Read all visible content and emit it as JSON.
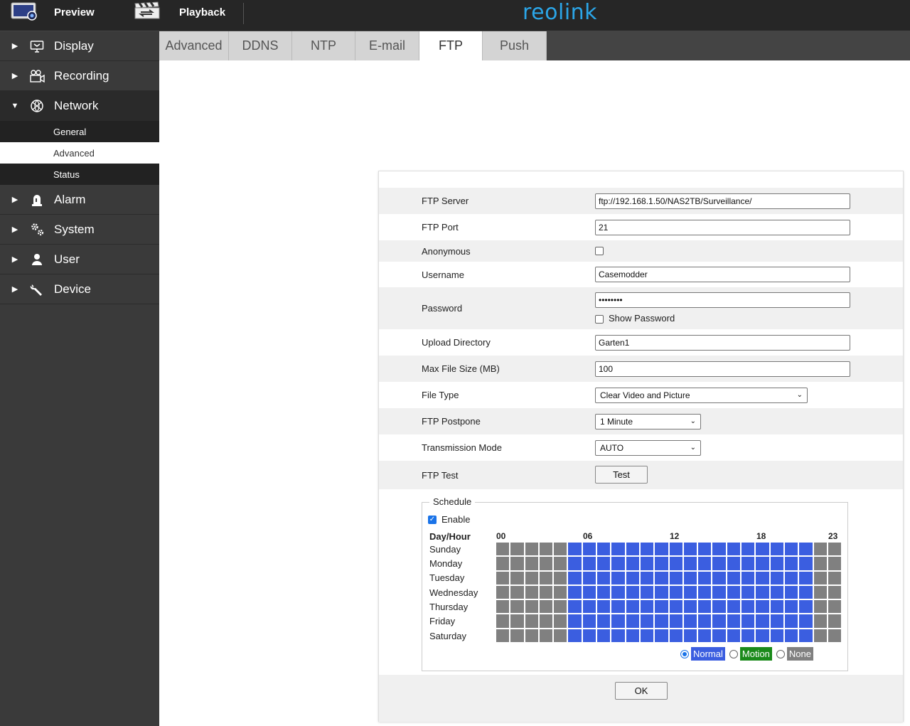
{
  "topbar": {
    "preview_label": "Preview",
    "playback_label": "Playback",
    "logo": "reolink"
  },
  "sidebar": {
    "items": [
      {
        "label": "Display",
        "icon": "monitor-icon"
      },
      {
        "label": "Recording",
        "icon": "camera-icon"
      },
      {
        "label": "Network",
        "icon": "network-globe-icon"
      },
      {
        "label": "Alarm",
        "icon": "alarm-icon"
      },
      {
        "label": "System",
        "icon": "gears-icon"
      },
      {
        "label": "User",
        "icon": "user-icon"
      },
      {
        "label": "Device",
        "icon": "wrench-icon"
      }
    ],
    "network_sub": [
      "General",
      "Advanced",
      "Status"
    ],
    "active_sub": "Advanced"
  },
  "tabs": [
    "Advanced",
    "DDNS",
    "NTP",
    "E-mail",
    "FTP",
    "Push"
  ],
  "active_tab": "FTP",
  "form": {
    "ftp_server_label": "FTP Server",
    "ftp_server_value": "ftp://192.168.1.50/NAS2TB/Surveillance/",
    "ftp_port_label": "FTP Port",
    "ftp_port_value": "21",
    "anonymous_label": "Anonymous",
    "username_label": "Username",
    "username_value": "Casemodder",
    "password_label": "Password",
    "password_value": "••••••••",
    "show_password_label": "Show Password",
    "upload_dir_label": "Upload Directory",
    "upload_dir_value": "Garten1",
    "max_file_label": "Max File Size (MB)",
    "max_file_value": "100",
    "file_type_label": "File Type",
    "file_type_value": "Clear Video and Picture",
    "postpone_label": "FTP Postpone",
    "postpone_value": "1 Minute",
    "transmission_label": "Transmission Mode",
    "transmission_value": "AUTO",
    "ftp_test_label": "FTP Test",
    "test_button": "Test",
    "ok_button": "OK"
  },
  "schedule": {
    "legend": "Schedule",
    "enable_label": "Enable",
    "enabled": true,
    "header_label": "Day/Hour",
    "hour_marks": [
      "00",
      "06",
      "12",
      "18",
      "23"
    ],
    "days": [
      "Sunday",
      "Monday",
      "Tuesday",
      "Wednesday",
      "Thursday",
      "Friday",
      "Saturday"
    ],
    "active_hours": [
      5,
      6,
      7,
      8,
      9,
      10,
      11,
      12,
      13,
      14,
      15,
      16,
      17,
      18,
      19,
      20,
      21
    ],
    "modes": [
      {
        "label": "Normal",
        "color": "#3b5ee0",
        "selected": true
      },
      {
        "label": "Motion",
        "color": "#1a8a1a",
        "selected": false
      },
      {
        "label": "None",
        "color": "#808080",
        "selected": false
      }
    ]
  }
}
